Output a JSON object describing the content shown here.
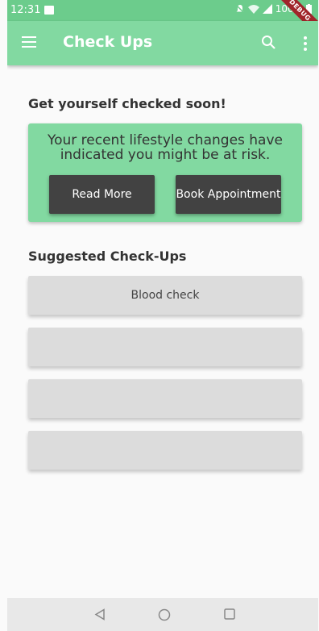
{
  "status_bar": {
    "time": "12:31",
    "battery": "100%",
    "debug_label": "DEBUG"
  },
  "app_bar": {
    "title": "Check Ups",
    "icons": [
      "menu-icon",
      "search-icon",
      "more-vert-icon"
    ]
  },
  "checked_section": {
    "heading": "Get yourself checked soon!",
    "card_text": "Your recent lifestyle changes have indicated you might be at risk.",
    "read_more_label": "Read More",
    "book_label": "Book Appointment"
  },
  "suggested_section": {
    "heading": "Suggested Check-Ups",
    "items": [
      {
        "label": "Blood check"
      },
      {
        "label": ""
      },
      {
        "label": ""
      },
      {
        "label": ""
      }
    ]
  },
  "colors": {
    "status_bar": "#6ccc8c",
    "app_bar": "#82d9a1",
    "card": "#82d9a1",
    "button": "#424242",
    "checkup_item": "#dcdcdc"
  },
  "nav_bar": {
    "icons": [
      "back-icon",
      "home-icon",
      "recents-icon"
    ]
  }
}
